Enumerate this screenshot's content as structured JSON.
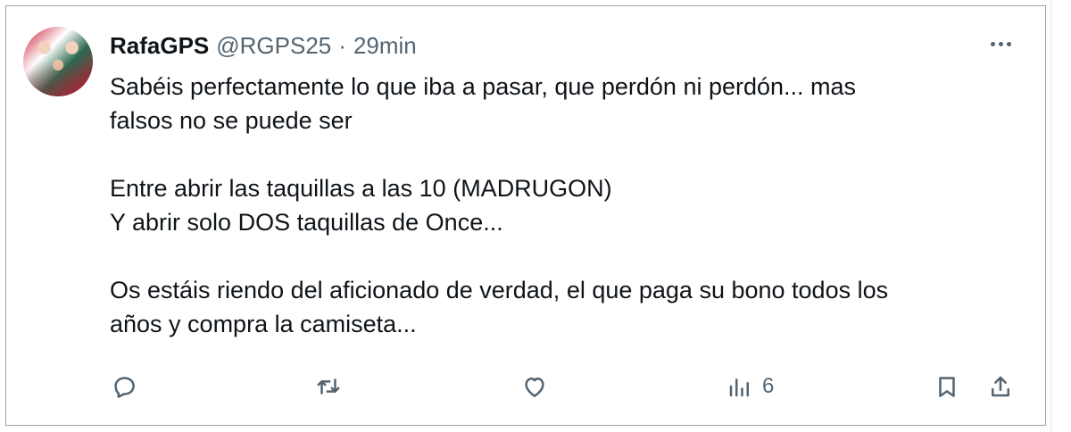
{
  "tweet": {
    "author_name": "RafaGPS",
    "handle": "@RGPS25",
    "separator": "·",
    "time": "29min",
    "paragraphs": [
      [
        "Sabéis perfectamente lo que iba a pasar, que perdón ni perdón... mas",
        "falsos no se puede ser"
      ],
      [
        "Entre abrir las taquillas a las 10 (MADRUGON)",
        "Y abrir solo DOS taquillas de Once..."
      ],
      [
        "Os estáis riendo del aficionado de verdad, el que paga su bono todos los",
        "años y compra la camiseta..."
      ]
    ],
    "actions": {
      "reply_icon": "reply-icon",
      "retweet_icon": "retweet-icon",
      "like_icon": "like-icon",
      "views_icon": "views-icon",
      "views_count": "6",
      "bookmark_icon": "bookmark-icon",
      "share_icon": "share-icon"
    }
  },
  "colors": {
    "text": "#0f1419",
    "secondary": "#536471",
    "border": "#9aa0a6"
  }
}
